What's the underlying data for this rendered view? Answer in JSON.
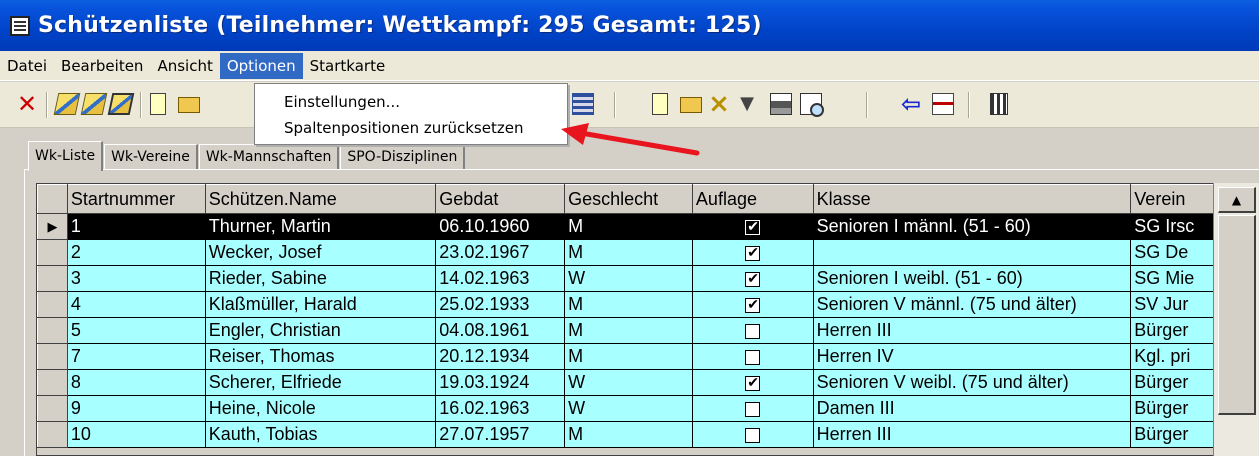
{
  "window": {
    "title": "Schützenliste (Teilnehmer: Wettkampf: 295 Gesamt: 125)"
  },
  "menu": {
    "items": [
      "Datei",
      "Bearbeiten",
      "Ansicht",
      "Optionen",
      "Startkarte"
    ],
    "active": "Optionen",
    "dropdown": [
      "Einstellungen...",
      "Spaltenpositionen zurücksetzen"
    ]
  },
  "toolbar": {
    "icons": [
      "close-icon",
      "open-book-icon",
      "book-icon",
      "book-grid-icon",
      "new-page-icon",
      "open-folder-icon",
      "grid-icon",
      "new-page-icon",
      "open-folder-icon",
      "delete-icon",
      "filter-icon",
      "print-icon",
      "print-preview-icon",
      "back-arrow-icon",
      "id-card-icon",
      "columns-icon"
    ]
  },
  "tabs": [
    "Wk-Liste",
    "Wk-Vereine",
    "Wk-Mannschaften",
    "SPO-Disziplinen"
  ],
  "active_tab": "Wk-Liste",
  "grid": {
    "columns": [
      "Startnummer",
      "Schützen.Name",
      "Gebdat",
      "Geschlecht",
      "Auflage",
      "Klasse",
      "Verein"
    ],
    "rows": [
      {
        "nr": "1",
        "name": "Thurner, Martin",
        "gebdat": "06.10.1960",
        "g": "M",
        "auflage": true,
        "klasse": "Senioren I männl. (51 - 60)",
        "verein": "SG Irsc"
      },
      {
        "nr": "2",
        "name": "Wecker, Josef",
        "gebdat": "23.02.1967",
        "g": "M",
        "auflage": true,
        "klasse": "",
        "verein": "SG De"
      },
      {
        "nr": "3",
        "name": "Rieder, Sabine",
        "gebdat": "14.02.1963",
        "g": "W",
        "auflage": true,
        "klasse": "Senioren I weibl. (51 - 60)",
        "verein": "SG Mie"
      },
      {
        "nr": "4",
        "name": "Klaßmüller, Harald",
        "gebdat": "25.02.1933",
        "g": "M",
        "auflage": true,
        "klasse": "Senioren V männl. (75 und älter)",
        "verein": "SV Jur"
      },
      {
        "nr": "5",
        "name": "Engler, Christian",
        "gebdat": "04.08.1961",
        "g": "M",
        "auflage": false,
        "klasse": "Herren III",
        "verein": "Bürger"
      },
      {
        "nr": "7",
        "name": "Reiser, Thomas",
        "gebdat": "20.12.1934",
        "g": "M",
        "auflage": false,
        "klasse": "Herren IV",
        "verein": "Kgl. pri"
      },
      {
        "nr": "8",
        "name": "Scherer, Elfriede",
        "gebdat": "19.03.1924",
        "g": "W",
        "auflage": true,
        "klasse": "Senioren V weibl. (75 und älter)",
        "verein": "Bürger"
      },
      {
        "nr": "9",
        "name": "Heine, Nicole",
        "gebdat": "16.02.1963",
        "g": "W",
        "auflage": false,
        "klasse": "Damen III",
        "verein": "Bürger"
      },
      {
        "nr": "10",
        "name": "Kauth, Tobias",
        "gebdat": "27.07.1957",
        "g": "M",
        "auflage": false,
        "klasse": "Herren III",
        "verein": "Bürger"
      }
    ],
    "selected_row": 0
  },
  "colors": {
    "title_bar": "#0054e3",
    "selected_menu": "#316ac5",
    "row_bg": "#a8ffff",
    "annotation_arrow": "#e8141e"
  }
}
